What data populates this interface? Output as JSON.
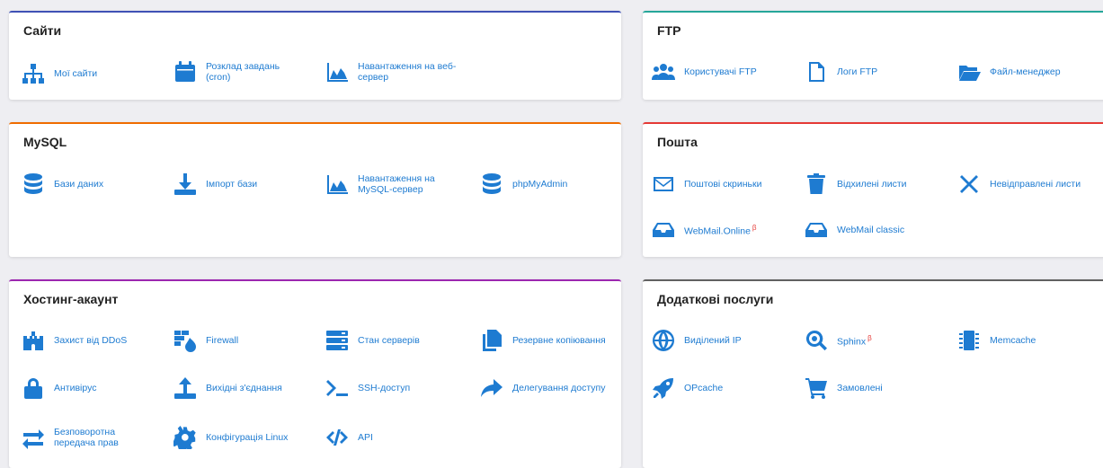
{
  "sites": {
    "title": "Сайти",
    "items": [
      "Мої сайти",
      "Розклад завдань (cron)",
      "Навантаження на веб-сервер"
    ]
  },
  "ftp": {
    "title": "FTP",
    "items": [
      "Користувачі FTP",
      "Логи FTP",
      "Файл-менеджер"
    ]
  },
  "mysql": {
    "title": "MySQL",
    "items": [
      "Бази даних",
      "Імпорт бази",
      "Навантаження на MySQL-сервер",
      "phpMyAdmin"
    ]
  },
  "mail": {
    "title": "Пошта",
    "items": [
      "Поштові скриньки",
      "Відхилені листи",
      "Невідправлені листи",
      "WebMail.Online",
      "WebMail classic"
    ],
    "beta_mark": "β"
  },
  "hosting": {
    "title": "Хостинг-акаунт",
    "items": [
      "Захист від DDoS",
      "Firewall",
      "Стан серверів",
      "Резервне копіювання",
      "Антивірус",
      "Вихідні з'єднання",
      "SSH-доступ",
      "Делегування доступу",
      "Безповоротна передача прав",
      "Конфігурація Linux",
      "API"
    ]
  },
  "extra": {
    "title": "Додаткові послуги",
    "items": [
      "Виділений IP",
      "Sphinx",
      "Memcache",
      "OPcache",
      "Замовлені"
    ],
    "beta_mark": "β"
  },
  "colors": {
    "link": "#1e7bd1",
    "sites_accent": "#3f51b5",
    "ftp_accent": "#26a69a",
    "mysql_accent": "#ef6c00",
    "mail_accent": "#e53935",
    "hosting_accent": "#9c27b0",
    "extra_accent": "#616161"
  }
}
